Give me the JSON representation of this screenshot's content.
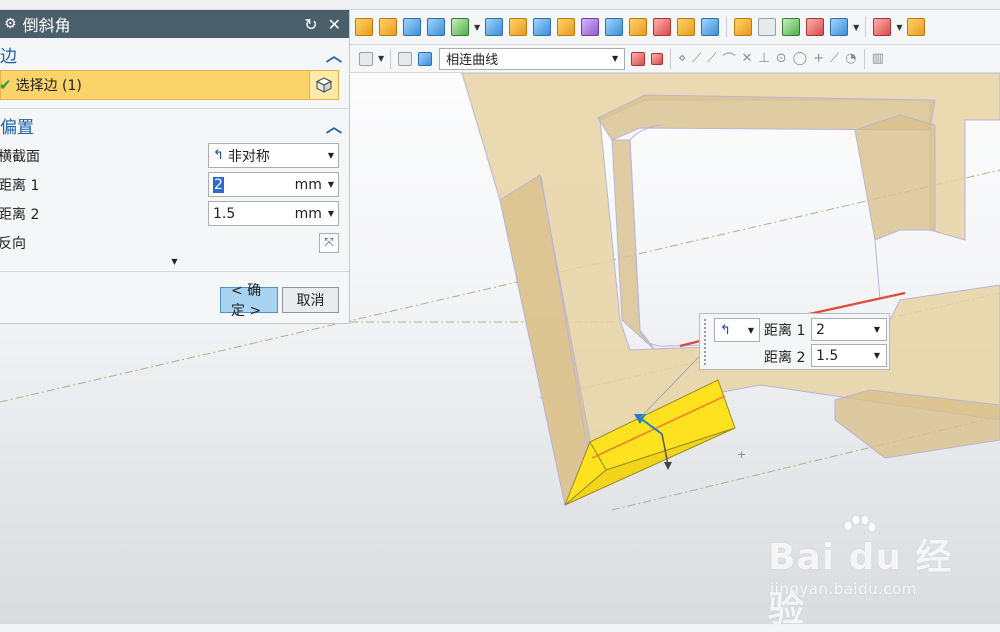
{
  "dialog": {
    "title": "倒斜角",
    "edge_group": {
      "title": "边",
      "select_edge_label": "选择边 (1)"
    },
    "offset_group": {
      "title": "偏置",
      "cross_section_label": "横截面",
      "cross_section_value": "非对称",
      "distance1_label": "距离 1",
      "distance1_value": "2",
      "distance1_unit": "mm",
      "distance2_label": "距离 2",
      "distance2_value": "1.5",
      "distance2_unit": "mm",
      "reverse_label": "反向"
    },
    "ok_label": "< 确定 >",
    "cancel_label": "取消"
  },
  "toolbar": {
    "curve_rule_value": "相连曲线"
  },
  "popup": {
    "distance1_label": "距离 1",
    "distance1_value": "2",
    "distance2_label": "距离 2",
    "distance2_value": "1.5"
  },
  "watermark": {
    "brand": "Bai du 经验",
    "url": "jingyan.baidu.com"
  },
  "colors": {
    "dialog_title_bg": "#4a5f6a",
    "selected_row": "#fbd36b",
    "ok_button": "#a8d4f2",
    "highlight_face": "#ffe21f",
    "model_body": "#e8d3a3",
    "edge_highlight": "#e0493a"
  }
}
